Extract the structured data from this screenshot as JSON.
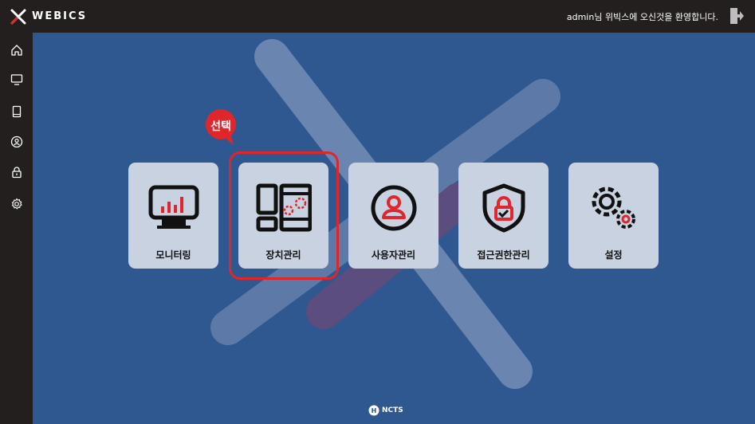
{
  "header": {
    "logo_text": "WEBICS",
    "welcome": "admin님 위빅스에 오신것을 환영합니다."
  },
  "sidebar": {
    "items": [
      {
        "icon": "home-icon"
      },
      {
        "icon": "monitor-icon"
      },
      {
        "icon": "tablet-icon"
      },
      {
        "icon": "user-icon"
      },
      {
        "icon": "lock-icon"
      },
      {
        "icon": "gear-icon"
      }
    ]
  },
  "cards": [
    {
      "label": "모니터링",
      "icon": "monitoring-icon"
    },
    {
      "label": "장치관리",
      "icon": "device-management-icon"
    },
    {
      "label": "사용자관리",
      "icon": "user-management-icon"
    },
    {
      "label": "접근권한관리",
      "icon": "access-control-icon"
    },
    {
      "label": "설정",
      "icon": "settings-icon"
    }
  ],
  "callout": {
    "text": "선택"
  },
  "footer": {
    "logo_text": "NCTS",
    "logo_badge": "H"
  },
  "colors": {
    "accent": "#e0262b",
    "background": "#2f5790",
    "bar": "#231f1f",
    "card": "#c9d2e1"
  }
}
